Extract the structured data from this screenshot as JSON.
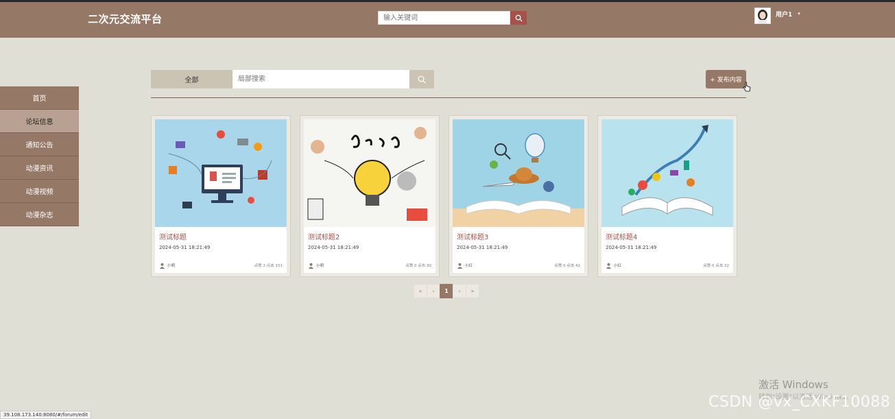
{
  "header": {
    "brand": "二次元交流平台",
    "search_placeholder": "输入关键词",
    "user_name": "用户1",
    "caret": "▾"
  },
  "sidebar": {
    "items": [
      {
        "label": "首页",
        "active": false
      },
      {
        "label": "论坛信息",
        "active": true
      },
      {
        "label": "通知公告",
        "active": false
      },
      {
        "label": "动漫资讯",
        "active": false
      },
      {
        "label": "动漫视频",
        "active": false
      },
      {
        "label": "动漫杂志",
        "active": false
      }
    ]
  },
  "filter": {
    "category_label": "全部",
    "search_placeholder": "局部搜索",
    "publish_label": "+ 发布内容"
  },
  "posts": [
    {
      "title": "测试标题",
      "date": "2024-05-31 18:21:49",
      "author": "小明",
      "stats": "点赞 2   点击 151"
    },
    {
      "title": "测试标题2",
      "date": "2024-05-31 18:21:49",
      "author": "小明",
      "stats": "点赞 0   点击 30"
    },
    {
      "title": "测试标题3",
      "date": "2024-05-31 18:21:49",
      "author": "小红",
      "stats": "点赞 0   点击 42"
    },
    {
      "title": "测试标题4",
      "date": "2024-05-31 18:21:49",
      "author": "小红",
      "stats": "点赞 0   点击 22"
    }
  ],
  "pagination": {
    "first": "«",
    "prev": "‹",
    "current": "1",
    "next": "›",
    "last": "»"
  },
  "status_bar": {
    "url": "39.108.173.140:8080/#/forum/edit"
  },
  "overlay": {
    "activate_title": "激活 Windows",
    "activate_sub": "转到\"设置\"以激活 Windows。",
    "watermark": "CSDN @vx_CXKF10088"
  },
  "colors": {
    "primary": "#957866",
    "accent": "#a8514a",
    "background": "#e0dfd5",
    "sidebar_active": "#b8a193"
  }
}
